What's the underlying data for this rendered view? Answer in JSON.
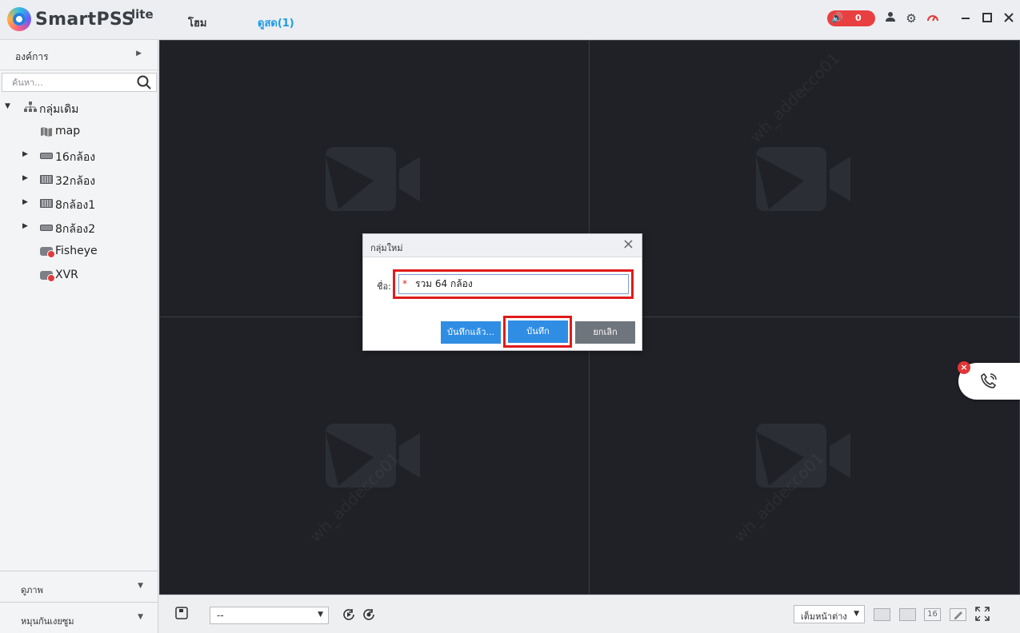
{
  "app": {
    "title": "SmartPSS",
    "title_sup": "lite"
  },
  "nav": {
    "home": "โฮม",
    "live": "ดูสด(1)"
  },
  "alarm": {
    "count": "0"
  },
  "sidebar": {
    "org_label": "องค์การ",
    "search_placeholder": "ค้นหา...",
    "tree": [
      {
        "label": "กลุ่มเดิม",
        "icon": "org-tree-icon",
        "expanded": true
      },
      {
        "label": "map",
        "icon": "map-icon"
      },
      {
        "label": "16กล้อง",
        "icon": "nvr-device-icon",
        "collapsed": true
      },
      {
        "label": "32กล้อง",
        "icon": "dvr-device-icon",
        "collapsed": true
      },
      {
        "label": "8กล้อง1",
        "icon": "dvr-device-icon",
        "collapsed": true
      },
      {
        "label": "8กล้อง2",
        "icon": "nvr-device-icon",
        "collapsed": true
      },
      {
        "label": "Fisheye",
        "icon": "offline-camera-icon"
      },
      {
        "label": "XVR",
        "icon": "offline-camera-icon"
      }
    ],
    "view_label": "ดูภาพ",
    "ptz_label": "หมุนกันเงยซูม"
  },
  "dialog": {
    "title": "กลุ่มใหม่",
    "name_label": "ชื่อ:",
    "required_mark": "*",
    "name_value": "รวม 64 กล้อง",
    "save_as_label": "บันทึกแล้ว...",
    "save_label": "บันทึก",
    "cancel_label": "ยกเลิก"
  },
  "controls": {
    "view_select_value": "--",
    "fit_window_label": "เต็มหน้าต่าง",
    "grid16_label": "16"
  },
  "watermark": "wh_addecco01",
  "colors": {
    "accent": "#1c9be6",
    "button": "#2f8de4",
    "highlight": "#e01b1b",
    "stage": "#1f2127",
    "alarm": "#e84040"
  }
}
